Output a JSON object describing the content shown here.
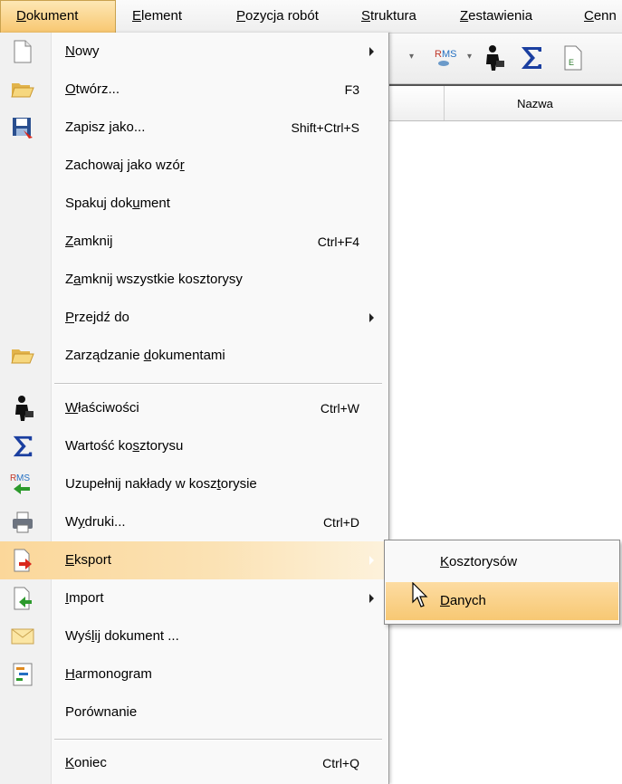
{
  "menubar": {
    "items": [
      {
        "label": "Dokument",
        "mnemonic": "D",
        "rest": "okument"
      },
      {
        "label": "Element",
        "mnemonic": "E",
        "rest": "lement"
      },
      {
        "label": "Pozycja robót",
        "mnemonic": "P",
        "rest": "ozycja robót"
      },
      {
        "label": "Struktura",
        "mnemonic": "S",
        "rest": "truktura"
      },
      {
        "label": "Zestawienia",
        "mnemonic": "Z",
        "rest": "estawienia"
      },
      {
        "label": "Cennik",
        "mnemonic": "C",
        "rest": "enn"
      }
    ]
  },
  "toolbar": {
    "icons": [
      "dropdown-arrow",
      "rms-icon",
      "dropdown-arrow",
      "person-briefcase-icon",
      "sigma-icon",
      "export-file-icon"
    ]
  },
  "grid": {
    "column_header": "Nazwa"
  },
  "menu": {
    "items": [
      {
        "pre": "",
        "u": "N",
        "post": "owy",
        "shortcut": "",
        "submenu": true,
        "icon": "new-document-icon"
      },
      {
        "pre": "",
        "u": "O",
        "post": "twórz...",
        "shortcut": "F3",
        "submenu": false,
        "icon": "open-folder-icon"
      },
      {
        "pre": "Zapisz ",
        "u": "j",
        "post": "ako...",
        "shortcut": "Shift+Ctrl+S",
        "submenu": false,
        "icon": "save-as-icon"
      },
      {
        "pre": "Zachowaj jako wzó",
        "u": "r",
        "post": "",
        "shortcut": "",
        "submenu": false,
        "icon": ""
      },
      {
        "pre": "Spakuj dok",
        "u": "u",
        "post": "ment",
        "shortcut": "",
        "submenu": false,
        "icon": ""
      },
      {
        "pre": "",
        "u": "Z",
        "post": "amknij",
        "shortcut": "Ctrl+F4",
        "submenu": false,
        "icon": ""
      },
      {
        "pre": "Z",
        "u": "a",
        "post": "mknij wszystkie kosztorysy",
        "shortcut": "",
        "submenu": false,
        "icon": ""
      },
      {
        "pre": "",
        "u": "P",
        "post": "rzejdź do",
        "shortcut": "",
        "submenu": true,
        "icon": ""
      },
      {
        "pre": "Zarządzanie ",
        "u": "d",
        "post": "okumentami",
        "shortcut": "",
        "submenu": false,
        "icon": "folder-manage-icon"
      },
      {
        "pre": "",
        "u": "W",
        "post": "łaściwości",
        "shortcut": "Ctrl+W",
        "submenu": false,
        "icon": "properties-person-icon"
      },
      {
        "pre": "Wartość ko",
        "u": "s",
        "post": "ztorysu",
        "shortcut": "",
        "submenu": false,
        "icon": "sigma-icon"
      },
      {
        "pre": "Uzupełnij nakłady w kosz",
        "u": "t",
        "post": "orysie",
        "shortcut": "",
        "submenu": false,
        "icon": "rms-fill-icon"
      },
      {
        "pre": "W",
        "u": "y",
        "post": "druki...",
        "shortcut": "Ctrl+D",
        "submenu": false,
        "icon": "printer-icon"
      },
      {
        "pre": "",
        "u": "E",
        "post": "ksport",
        "shortcut": "",
        "submenu": true,
        "icon": "export-icon"
      },
      {
        "pre": "",
        "u": "I",
        "post": "mport",
        "shortcut": "",
        "submenu": true,
        "icon": "import-icon"
      },
      {
        "pre": "Wyś",
        "u": "l",
        "post": "ij dokument ...",
        "shortcut": "",
        "submenu": false,
        "icon": "envelope-icon"
      },
      {
        "pre": "",
        "u": "H",
        "post": "armonogram",
        "shortcut": "",
        "submenu": false,
        "icon": "gantt-icon"
      },
      {
        "pre": "Porównanie",
        "u": "",
        "post": "",
        "shortcut": "",
        "submenu": false,
        "icon": ""
      },
      {
        "pre": "",
        "u": "K",
        "post": "oniec",
        "shortcut": "Ctrl+Q",
        "submenu": false,
        "icon": ""
      }
    ]
  },
  "submenu": {
    "items": [
      {
        "pre": "",
        "u": "K",
        "post": "osztorysów"
      },
      {
        "pre": "",
        "u": "D",
        "post": "anych"
      }
    ]
  },
  "colors": {
    "highlight": "#f8c770",
    "menu_bg": "#f9f9f9",
    "accent_red": "#d9271c",
    "accent_green": "#2c9a2c",
    "sigma_blue": "#1b3fa0"
  }
}
